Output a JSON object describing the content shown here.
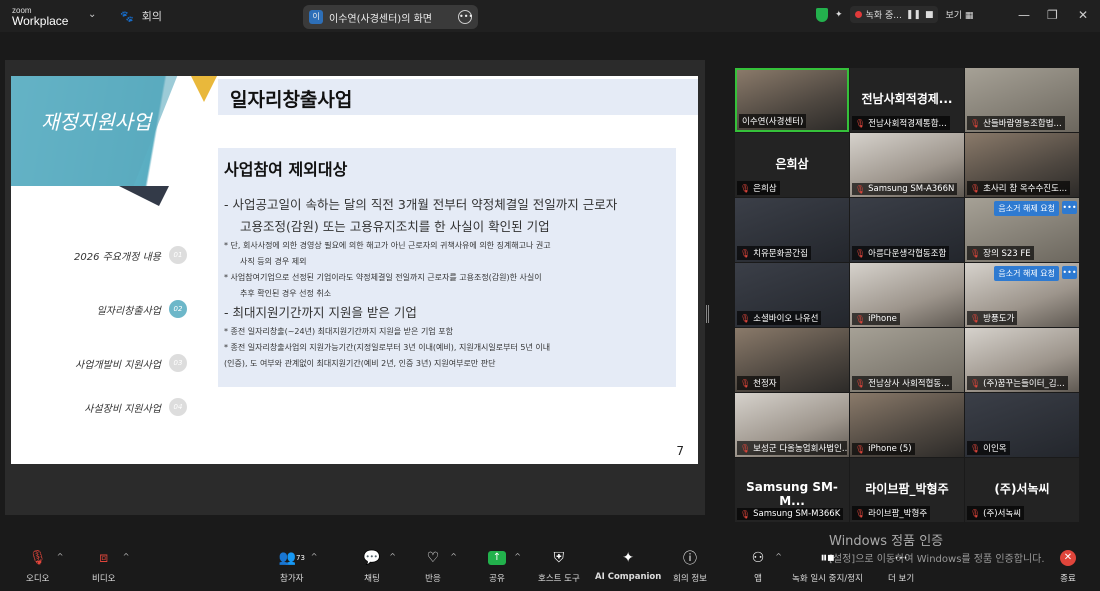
{
  "app": {
    "logo_line1": "zoom",
    "logo_line2": "Workplace"
  },
  "topbar": {
    "meeting_label": "회의",
    "share_tab_avatar": "이",
    "share_tab_label": "이수연(사경센터)의 화면",
    "recording_label": "녹화 중...",
    "view_label": "보기"
  },
  "slide": {
    "side_title": "재정지원사업",
    "header": "일자리창출사업",
    "nav": [
      {
        "label": "2026 주요개정 내용",
        "num": "01"
      },
      {
        "label": "일자리창출사업",
        "num": "02"
      },
      {
        "label": "사업개발비 지원사업",
        "num": "03"
      },
      {
        "label": "사설장비 지원사업",
        "num": "04"
      }
    ],
    "section_title": "사업참여 제외대상",
    "item1_line1": "-   사업공고일이 속하는 달의 직전 3개월 전부터 약정체결일 전일까지 근로자",
    "item1_line2": "고용조정(감원) 또는 고용유지조치를 한 사실이 확인된 기업",
    "note1_line1": "* 단, 회사사정에 의한 경영상 필요에 의한 해고가 아닌 근로자의 귀책사유에 의한 징계해고나 권고",
    "note1_line2": "사직 등의 경우 제외",
    "note2_line1": "* 사업참여기업으로 선정된 기업이라도 약정체결일 전일까지 근로자를 고용조정(감원)한 사실이",
    "note2_line2": "추후 확인된 경우 선정 취소",
    "item2": "-   최대지원기간까지 지원을 받은 기업",
    "note3": "* 종전 일자리창출(~24년) 최대지원기간까지 지원을 받은 기업 포함",
    "note4_line1": "* 종전 일자리창출사업의 지원가능기간(지정일로부터 3년 이내(예비), 지원개시일로부터 5년 이내",
    "note4_line2": "(인증), 도 여부와 관계없이 최대지원기간(예비 2년, 인증 3년) 지원여부로만 판단",
    "page_number": "7"
  },
  "gallery": [
    {
      "name": "이수연(사경센터)",
      "big": "",
      "active": true,
      "muted": false,
      "style": "cam"
    },
    {
      "name": "전남사회적경제통합...",
      "big": "전남사회적경제...",
      "active": false,
      "muted": true,
      "style": "plain"
    },
    {
      "name": "산들바람영농조합법...",
      "big": "",
      "active": false,
      "muted": true,
      "style": "cam4"
    },
    {
      "name": "은희삼",
      "big": "은희삼",
      "active": false,
      "muted": true,
      "style": "plain"
    },
    {
      "name": "Samsung SM-A366N",
      "big": "",
      "active": false,
      "muted": true,
      "style": "cam2"
    },
    {
      "name": "초사리 참 옥수수진도...",
      "big": "",
      "active": false,
      "muted": true,
      "style": "cam"
    },
    {
      "name": "치유문화공간집",
      "big": "",
      "active": false,
      "muted": true,
      "style": "cam3"
    },
    {
      "name": "아름다운생각협동조합",
      "big": "",
      "active": false,
      "muted": true,
      "style": "cam3"
    },
    {
      "name": "장의 S23 FE",
      "big": "",
      "active": false,
      "muted": true,
      "style": "cam4",
      "request": "음소거 해제 요청"
    },
    {
      "name": "소셜바이오 나유선",
      "big": "",
      "active": false,
      "muted": true,
      "style": "cam3"
    },
    {
      "name": "iPhone",
      "big": "",
      "active": false,
      "muted": true,
      "style": "cam2"
    },
    {
      "name": "방풍도가",
      "big": "",
      "active": false,
      "muted": true,
      "style": "cam2",
      "request": "음소거 해제 요청"
    },
    {
      "name": "천정자",
      "big": "",
      "active": false,
      "muted": true,
      "style": "cam"
    },
    {
      "name": "전남상사 사회적협동...",
      "big": "",
      "active": false,
      "muted": true,
      "style": "cam4"
    },
    {
      "name": "(주)꿈꾸는들이터_김...",
      "big": "",
      "active": false,
      "muted": true,
      "style": "cam2"
    },
    {
      "name": "보성군 다올농업회사법인...",
      "big": "",
      "active": false,
      "muted": true,
      "style": "cam2"
    },
    {
      "name": "iPhone (5)",
      "big": "",
      "active": false,
      "muted": true,
      "style": "cam"
    },
    {
      "name": "이인옥",
      "big": "",
      "active": false,
      "muted": true,
      "style": "cam3"
    },
    {
      "name": "Samsung SM-M366K",
      "big": "Samsung SM-M...",
      "active": false,
      "muted": true,
      "style": "plain"
    },
    {
      "name": "라이브팜_박형주",
      "big": "라이브팜_박형주",
      "active": false,
      "muted": true,
      "style": "plain"
    },
    {
      "name": "(주)서녹씨",
      "big": "(주)서녹씨",
      "active": false,
      "muted": true,
      "style": "plain"
    }
  ],
  "watermark": {
    "line1": "Windows 정품 인증",
    "line2": "[설정]으로 이동하여 Windows를 정품 인증합니다."
  },
  "toolbar": {
    "audio": "오디오",
    "video": "비디오",
    "participants": "참가자",
    "participants_count": "73",
    "chat": "채팅",
    "reactions": "반응",
    "share": "공유",
    "host_tools": "호스트 도구",
    "ai_companion": "AI Companion",
    "meeting_info": "회의 정보",
    "apps": "앱",
    "recording": "녹화 일시 중지/정지",
    "more": "더 보기",
    "end": "종료"
  }
}
